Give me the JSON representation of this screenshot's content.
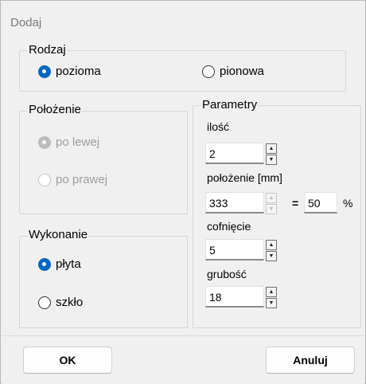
{
  "window": {
    "title": "Dodaj"
  },
  "rodzaj": {
    "label": "Rodzaj",
    "options": [
      {
        "label": "pozioma",
        "checked": true
      },
      {
        "label": "pionowa",
        "checked": false
      }
    ]
  },
  "polozenie": {
    "label": "Położenie",
    "options": [
      {
        "label": "po lewej",
        "checked": true,
        "disabled": true
      },
      {
        "label": "po prawej",
        "checked": false,
        "disabled": true
      }
    ]
  },
  "wykonanie": {
    "label": "Wykonanie",
    "options": [
      {
        "label": "płyta",
        "checked": true
      },
      {
        "label": "szkło",
        "checked": false
      }
    ]
  },
  "parametry": {
    "label": "Parametry",
    "ilosc": {
      "label": "ilość",
      "value": "2"
    },
    "polozenie_mm": {
      "label": "położenie [mm]",
      "value": "333",
      "equals": "=",
      "percent_value": "50",
      "percent_sign": "%"
    },
    "cofniecie": {
      "label": "cofnięcie",
      "value": "5"
    },
    "grubosc": {
      "label": "grubość",
      "value": "18"
    }
  },
  "buttons": {
    "ok": "OK",
    "cancel": "Anuluj"
  },
  "colors": {
    "accent": "#0067c0",
    "dialog_bg": "#f0f0f0",
    "disabled_text": "#9d9d9d"
  }
}
